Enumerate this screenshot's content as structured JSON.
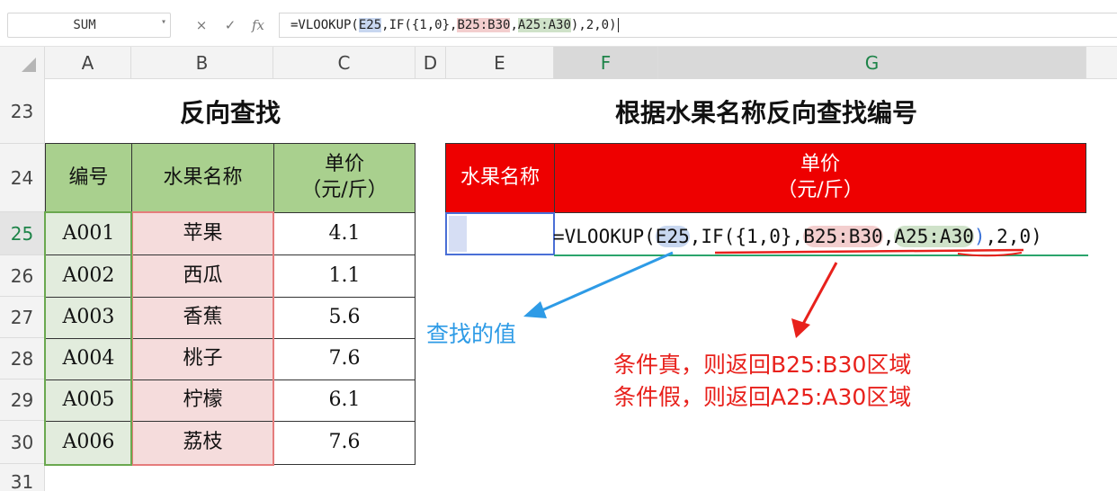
{
  "namebox": {
    "value": "SUM"
  },
  "formula_bar": {
    "cancel": "×",
    "confirm": "✓",
    "fx": "fx",
    "parts": [
      "=VLOOKUP(",
      "E25",
      ",IF({1,0},",
      "B25:B30",
      ",",
      "A25:A30",
      "),2,0)"
    ]
  },
  "columns": [
    "A",
    "B",
    "C",
    "D",
    "E",
    "F",
    "G"
  ],
  "rows": [
    "23",
    "24",
    "25",
    "26",
    "27",
    "28",
    "29",
    "30",
    "31"
  ],
  "left_table": {
    "title": "反向查找",
    "headers": [
      "编号",
      "水果名称",
      "单价\n（元/斤）"
    ],
    "rows": [
      [
        "A001",
        "苹果",
        "4.1"
      ],
      [
        "A002",
        "西瓜",
        "1.1"
      ],
      [
        "A003",
        "香蕉",
        "5.6"
      ],
      [
        "A004",
        "桃子",
        "7.6"
      ],
      [
        "A005",
        "柠檬",
        "6.1"
      ],
      [
        "A006",
        "荔枝",
        "7.6"
      ]
    ]
  },
  "right_table": {
    "title": "根据水果名称反向查找编号",
    "headers": [
      "水果名称",
      "单价\n（元/斤）"
    ],
    "formula_parts": [
      "=VLOOKUP(",
      "E25",
      ",",
      "IF(",
      "{1,0},",
      "B25:B30",
      ",",
      "A25:A30",
      ")",
      ",2,0)"
    ]
  },
  "annotations": {
    "lookup_value": "查找的值",
    "cond_true": "条件真，则返回B25:B30区域",
    "cond_false": "条件假，则返回A25:A30区域"
  },
  "colors": {
    "header_green": "#a9d08e",
    "header_red": "#ee0000",
    "arrow_blue": "#2e9be6",
    "annotation_red": "#e8211c"
  }
}
